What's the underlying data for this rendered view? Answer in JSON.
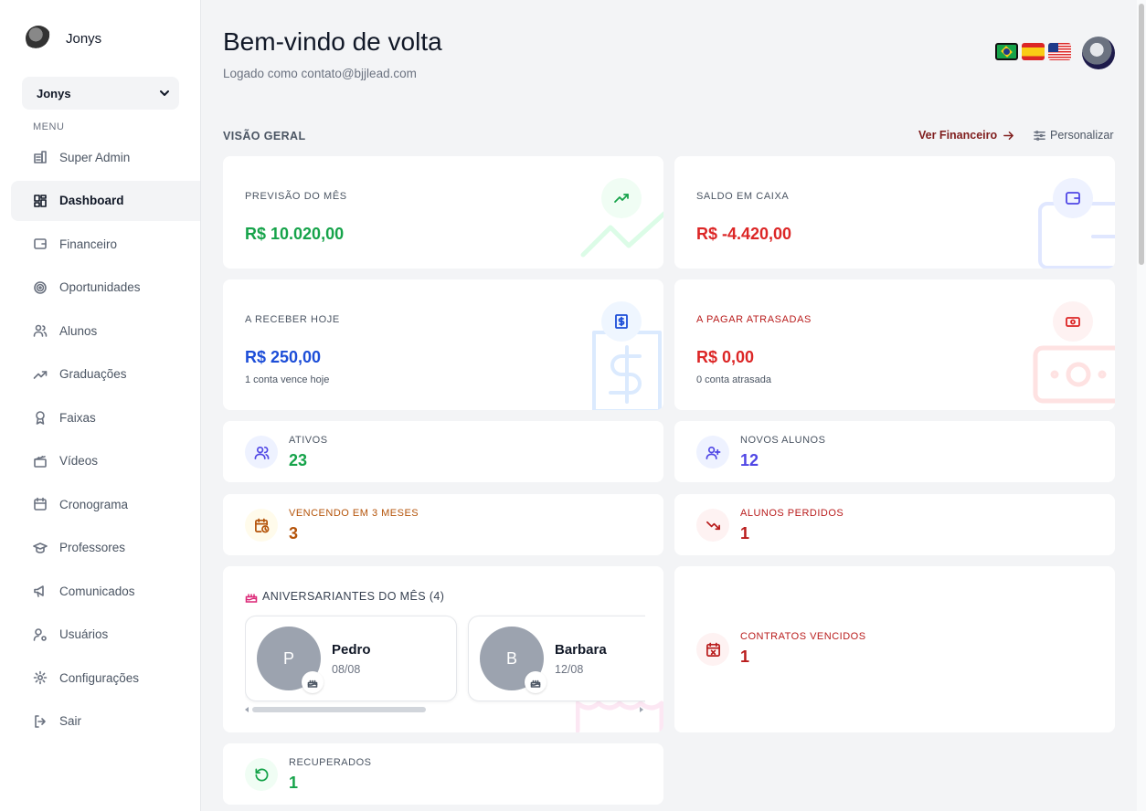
{
  "sidebar": {
    "brand_name": "Jonys",
    "select_value": "Jonys",
    "menu_label": "MENU",
    "items": [
      {
        "label": "Super Admin",
        "icon": "building-icon"
      },
      {
        "label": "Dashboard",
        "icon": "grid-icon",
        "active": true
      },
      {
        "label": "Financeiro",
        "icon": "wallet-icon"
      },
      {
        "label": "Oportunidades",
        "icon": "target-icon"
      },
      {
        "label": "Alunos",
        "icon": "users-icon"
      },
      {
        "label": "Graduações",
        "icon": "trending-up-icon"
      },
      {
        "label": "Faixas",
        "icon": "award-icon"
      },
      {
        "label": "Vídeos",
        "icon": "clapperboard-icon"
      },
      {
        "label": "Cronograma",
        "icon": "calendar-icon"
      },
      {
        "label": "Professores",
        "icon": "graduation-cap-icon"
      },
      {
        "label": "Comunicados",
        "icon": "megaphone-icon"
      },
      {
        "label": "Usuários",
        "icon": "user-cog-icon"
      },
      {
        "label": "Configurações",
        "icon": "settings-icon"
      },
      {
        "label": "Sair",
        "icon": "log-out-icon"
      }
    ]
  },
  "header": {
    "title": "Bem-vindo de volta",
    "subtitle": "Logado como contato@bjjlead.com",
    "languages": [
      "pt-BR",
      "es",
      "en-US"
    ]
  },
  "overview": {
    "section_label": "VISÃO GERAL",
    "ver_financeiro": "Ver Financeiro",
    "personalizar": "Personalizar"
  },
  "cards": {
    "previsao": {
      "label": "PREVISÃO DO MÊS",
      "value": "R$ 10.020,00"
    },
    "saldo": {
      "label": "SALDO EM CAIXA",
      "value": "R$ -4.420,00"
    },
    "receber": {
      "label": "A RECEBER HOJE",
      "value": "R$ 250,00",
      "note": "1 conta vence hoje"
    },
    "pagar": {
      "label": "A PAGAR ATRASADAS",
      "value": "R$ 0,00",
      "note": "0 conta atrasada"
    },
    "ativos": {
      "label": "ATIVOS",
      "value": "23"
    },
    "novos": {
      "label": "NOVOS ALUNOS",
      "value": "12"
    },
    "vencendo": {
      "label": "VENCENDO EM 3 MESES",
      "value": "3"
    },
    "perdidos": {
      "label": "ALUNOS PERDIDOS",
      "value": "1"
    },
    "contratos": {
      "label": "CONTRATOS VENCIDOS",
      "value": "1"
    },
    "recuperados": {
      "label": "RECUPERADOS",
      "value": "1"
    }
  },
  "birthdays": {
    "title": "ANIVERSARIANTES DO MÊS (4)",
    "people": [
      {
        "initial": "P",
        "name": "Pedro",
        "date": "08/08"
      },
      {
        "initial": "B",
        "name": "Barbara",
        "date": "12/08"
      }
    ]
  },
  "colors": {
    "green": "#16a34a",
    "red": "#dc2626",
    "blue": "#1d4ed8",
    "purple": "#4f46e5",
    "amber": "#b45309",
    "brand_dark_red": "#7f1d1d"
  }
}
